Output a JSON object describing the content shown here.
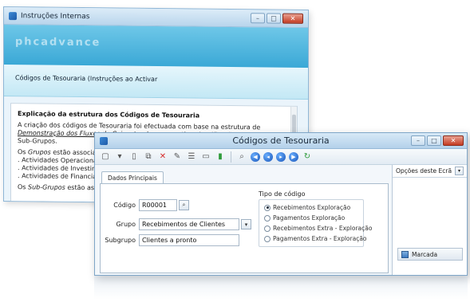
{
  "back_window": {
    "title": "Instruções Internas",
    "banner_logo": "phcadvance",
    "subheading": "Códigos de Tesouraria (Instruções ao Activar",
    "doc": {
      "heading": "Explicação da estrutura dos Códigos de Tesouraria",
      "para1_a": "A criação dos códigos de Tesouraria foi efectuada com base na estrutura de ",
      "para1_link": "Demonstração dos Fluxos de Caixa",
      "para1_b": ", tendo a respectiva classificação em Grupos e Sub-Grupos.",
      "grupos_line_a": "Os ",
      "grupos_em": "Grupos",
      "grupos_line_b": " estão associados à",
      "list": [
        ". Actividades Operacionais",
        ". Actividades de Investimento",
        ". Actividades de Financiament"
      ],
      "sub_a": "Os ",
      "sub_em": "Sub-Grupos",
      "sub_b": " estão associ"
    }
  },
  "front_window": {
    "title": "Códigos de Tesouraria",
    "tab": "Dados Principais",
    "fields": {
      "codigo_label": "Código",
      "codigo_value": "R00001",
      "grupo_label": "Grupo",
      "grupo_value": "Recebimentos de Clientes",
      "subgrupo_label": "Subgrupo",
      "subgrupo_value": "Clientes a pronto"
    },
    "tipo": {
      "title": "Tipo de código",
      "options": [
        "Recebimentos Exploração",
        "Pagamentos Exploração",
        "Recebimentos Extra - Exploração",
        "Pagamentos Extra - Exploração"
      ],
      "selected_index": 0
    },
    "side": {
      "header": "Opções deste Ecrã",
      "marcada": "Marcada"
    }
  },
  "colors": {
    "banner": "#3aa8d6",
    "titlebar": "#b9d5ec",
    "close_button": "#c43b22"
  }
}
